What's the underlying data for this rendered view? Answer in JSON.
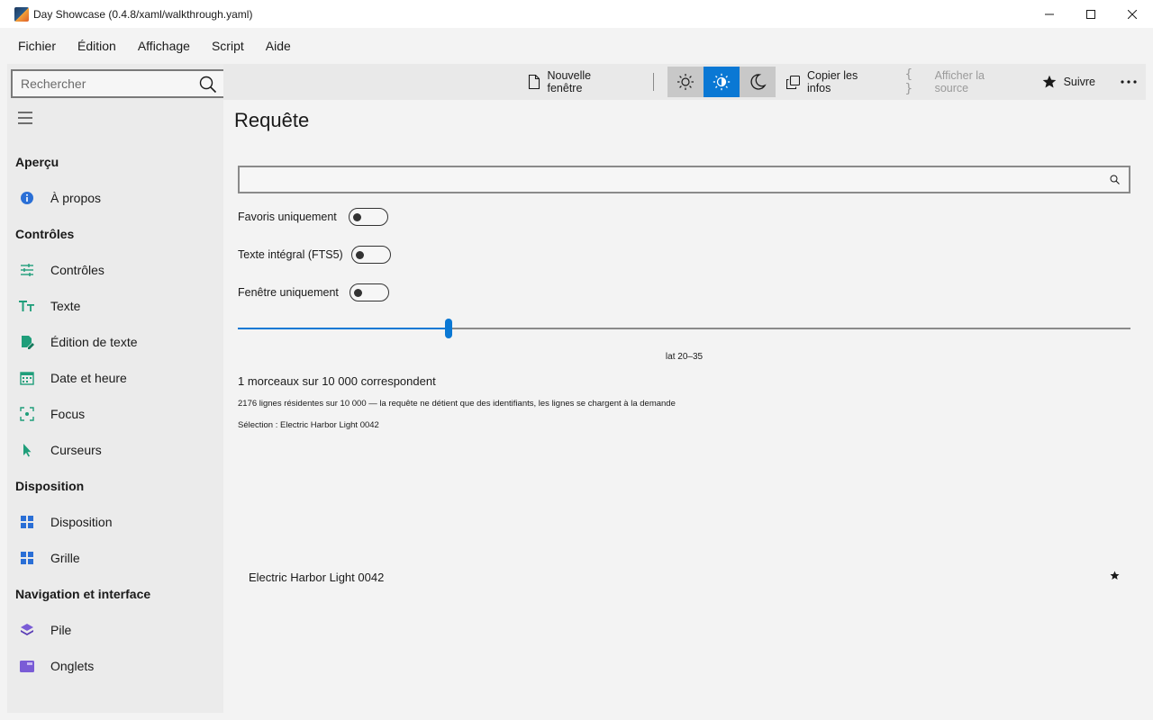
{
  "window": {
    "title": "Day Showcase (0.4.8/xaml/walkthrough.yaml)"
  },
  "menu": [
    "Fichier",
    "Édition",
    "Affichage",
    "Script",
    "Aide"
  ],
  "sidebar": {
    "search_placeholder": "Rechercher",
    "sections": [
      {
        "header": "Aperçu",
        "items": [
          {
            "label": "À propos",
            "icon": "info-icon"
          }
        ]
      },
      {
        "header": "Contrôles",
        "items": [
          {
            "label": "Contrôles",
            "icon": "sliders-icon"
          },
          {
            "label": "Texte",
            "icon": "text-icon"
          },
          {
            "label": "Édition de texte",
            "icon": "edit-document-icon"
          },
          {
            "label": "Date et heure",
            "icon": "calendar-icon"
          },
          {
            "label": "Focus",
            "icon": "focus-icon"
          },
          {
            "label": "Curseurs",
            "icon": "cursor-icon"
          }
        ]
      },
      {
        "header": "Disposition",
        "items": [
          {
            "label": "Disposition",
            "icon": "layout-icon"
          },
          {
            "label": "Grille",
            "icon": "grid-icon"
          }
        ]
      },
      {
        "header": "Navigation et interface",
        "items": [
          {
            "label": "Pile",
            "icon": "stack-icon"
          },
          {
            "label": "Onglets",
            "icon": "tabs-icon"
          }
        ]
      }
    ]
  },
  "toolbar": {
    "new_window": "Nouvelle fenêtre",
    "copy_info": "Copier les infos",
    "show_source": "Afficher la source",
    "follow": "Suivre",
    "theme_selected": "auto"
  },
  "content": {
    "title": "Requête",
    "query_value": "",
    "toggles": [
      {
        "label": "Favoris uniquement",
        "on": false
      },
      {
        "label": "Texte intégral (FTS5)",
        "on": false
      },
      {
        "label": "Fenêtre uniquement",
        "on": false
      }
    ],
    "slider": {
      "value_fraction": 0.236,
      "label": "lat 20–35"
    },
    "count_text": "1 morceaux sur 10 000 correspondent",
    "detail_text": "2176 lignes résidentes sur 10 000 — la requête ne détient que des identifiants, les lignes se chargent à la demande",
    "selection_text": "Sélection : Electric Harbor Light 0042",
    "results": [
      {
        "name": "Electric Harbor Light 0042",
        "favorite": true
      }
    ]
  },
  "colors": {
    "accent": "#0a78d4",
    "sidebar_bg": "#ebebeb",
    "cmdbar_bg": "#e9e9e9"
  }
}
